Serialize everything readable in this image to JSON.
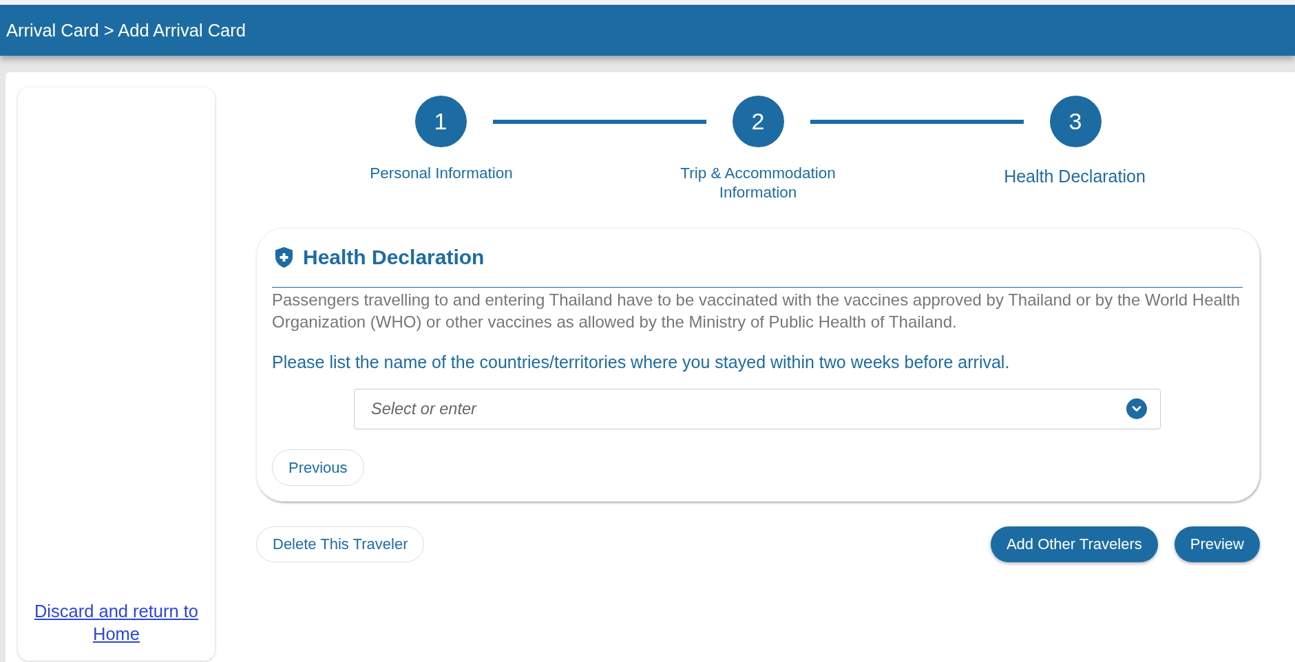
{
  "header": {
    "breadcrumb": "Arrival Card > Add Arrival Card"
  },
  "sidebar": {
    "link": "Discard and return to Home"
  },
  "steps": [
    {
      "number": "1",
      "label": "Personal Information",
      "selected": false
    },
    {
      "number": "2",
      "label": "Trip & Accommodation Information",
      "selected": false
    },
    {
      "number": "3",
      "label": "Health Declaration",
      "selected": true
    }
  ],
  "section": {
    "title": "Health Declaration",
    "notice": "Passengers travelling to and entering Thailand have to be vaccinated with the vaccines approved by Thailand or by the World Health Organization (WHO) or other vaccines as allowed by the Ministry of Public Health of Thailand.",
    "question": "Please list the name of the countries/territories where you stayed within two weeks before arrival.",
    "country_select": {
      "placeholder": "Select or enter"
    },
    "previous_button": "Previous"
  },
  "footer": {
    "left": [
      {
        "label": "Delete This Traveler",
        "kind": "outline"
      }
    ],
    "right": [
      {
        "label": "Add Other Travelers",
        "kind": "primary"
      },
      {
        "label": "Preview",
        "kind": "primary"
      }
    ]
  }
}
